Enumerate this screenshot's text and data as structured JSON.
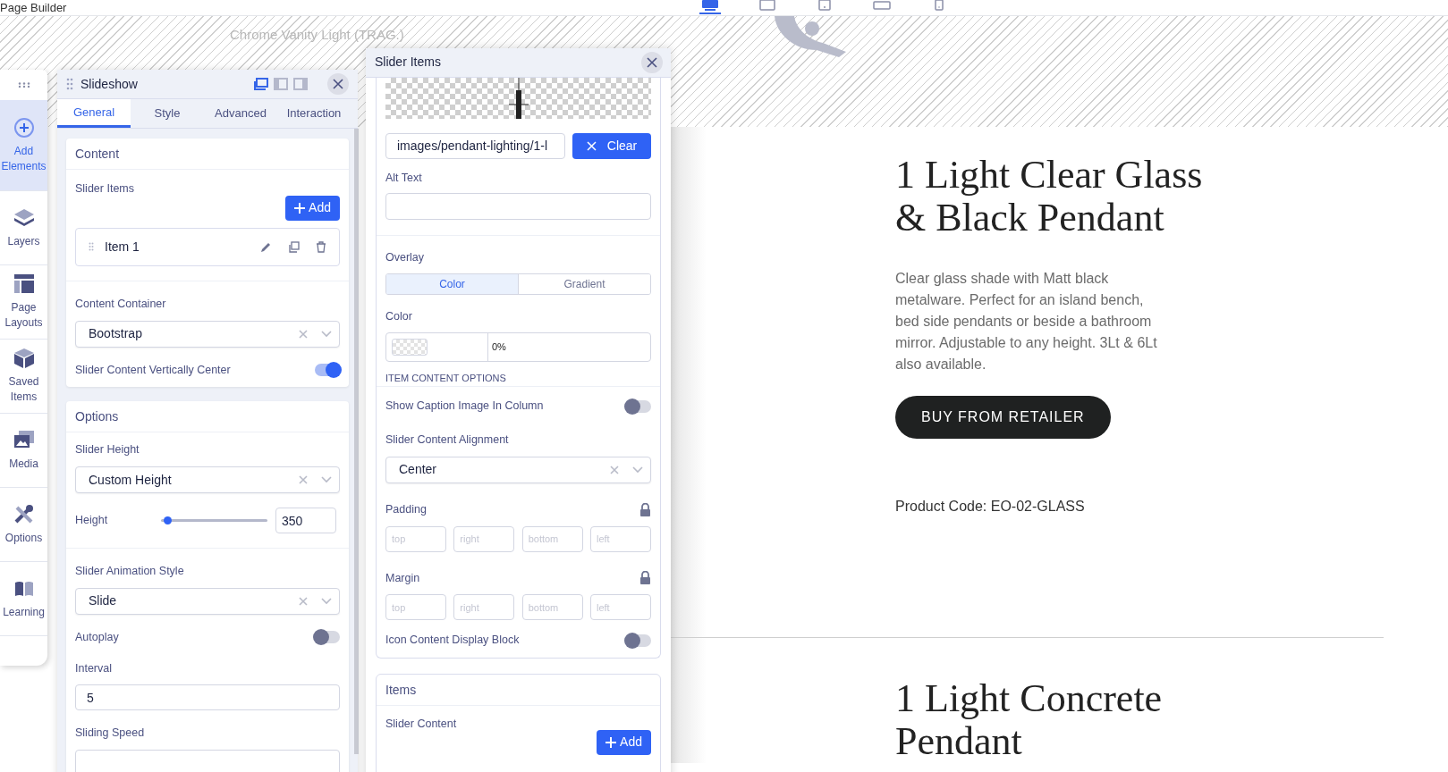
{
  "app": {
    "title": "Page Builder"
  },
  "device_bar": [
    {
      "kind": "desktop",
      "selected": true
    },
    {
      "kind": "tablet-landscape",
      "selected": false
    },
    {
      "kind": "tablet",
      "selected": false
    },
    {
      "kind": "phone-landscape",
      "selected": false
    },
    {
      "kind": "phone",
      "selected": false
    }
  ],
  "canvas": {
    "page_label": "Chrome Vanity Light (TRAG.)"
  },
  "sidebar": {
    "items": [
      {
        "kind": "add",
        "label": "Add Elements",
        "selected": true
      },
      {
        "kind": "layers",
        "label": "Layers",
        "selected": false
      },
      {
        "kind": "layouts",
        "label": "Page Layouts",
        "selected": false
      },
      {
        "kind": "saved",
        "label": "Saved Items",
        "selected": false
      },
      {
        "kind": "media",
        "label": "Media",
        "selected": false
      },
      {
        "kind": "options",
        "label": "Options",
        "selected": false
      },
      {
        "kind": "learning",
        "label": "Learning",
        "selected": false
      }
    ]
  },
  "slideshow_panel": {
    "title": "Slideshow",
    "view_modes": [
      {
        "selected": true
      },
      {
        "selected": false
      },
      {
        "selected": false
      }
    ],
    "tabs": [
      {
        "label": "General",
        "selected": true
      },
      {
        "label": "Style",
        "selected": false
      },
      {
        "label": "Advanced",
        "selected": false
      },
      {
        "label": "Interaction",
        "selected": false
      }
    ],
    "sections": [
      {
        "title": "Content",
        "fields": [
          {
            "kind": "list",
            "label": "Slider Items",
            "add_button": "Add",
            "items": [
              "Item 1"
            ]
          },
          {
            "kind": "select",
            "label": "Content Container",
            "value": "Bootstrap",
            "separated": true
          },
          {
            "kind": "toggle",
            "label": "Slider Content Vertically Center",
            "on": true
          }
        ]
      },
      {
        "title": "Options",
        "fields": [
          {
            "kind": "select",
            "label": "Slider Height",
            "value": "Custom Height"
          },
          {
            "kind": "slider",
            "label": "Height",
            "level": 0.06,
            "value": "350"
          },
          {
            "kind": "select",
            "label": "Slider Animation Style",
            "value": "Slide",
            "separated": true
          },
          {
            "kind": "toggle",
            "label": "Autoplay",
            "on": false
          },
          {
            "kind": "input",
            "label": "Interval",
            "value": "5"
          },
          {
            "kind": "input",
            "label": "Sliding Speed"
          }
        ]
      }
    ]
  },
  "slider_items_panel": {
    "title": "Slider Items",
    "image": {
      "path": "images/pendant-lighting/1-l",
      "clear_button": "Clear"
    },
    "alt_text": {
      "label": "Alt Text"
    },
    "overlay": {
      "label": "Overlay",
      "options": [
        {
          "label": "Color",
          "selected": true
        },
        {
          "label": "Gradient",
          "selected": false
        }
      ]
    },
    "color": {
      "label": "Color",
      "opacity": "0%"
    },
    "item_content_options": {
      "heading": "ITEM CONTENT OPTIONS",
      "fields": [
        {
          "kind": "toggle",
          "label": "Show Caption Image In Column",
          "on": false
        },
        {
          "kind": "select",
          "label": "Slider Content Alignment",
          "value": "Center"
        },
        {
          "kind": "spacing",
          "label": "Padding",
          "placeholders": [
            "top",
            "right",
            "bottom",
            "left"
          ]
        },
        {
          "kind": "spacing",
          "label": "Margin",
          "placeholders": [
            "top",
            "right",
            "bottom",
            "left"
          ]
        },
        {
          "kind": "toggle",
          "label": "Icon Content Display Block",
          "on": false
        }
      ]
    },
    "items_section": {
      "title": "Items",
      "label": "Slider Content",
      "add_button": "Add"
    }
  },
  "products": [
    {
      "title": "1 Light Clear Glass & Black Pendant",
      "description": "Clear glass shade with Matt black metalware. Perfect for an island bench, bed side pendants or beside a bathroom mirror. Adjustable to any height. 3Lt & 6Lt also available.",
      "button": "BUY FROM RETAILER",
      "product_code": "Product Code: EO-02-GLASS"
    },
    {
      "title": "1 Light Concrete Pendant"
    }
  ]
}
